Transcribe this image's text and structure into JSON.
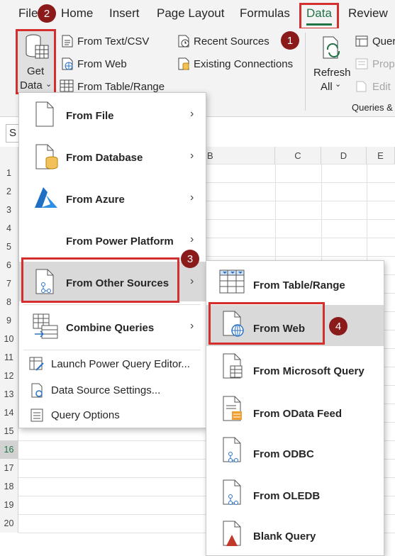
{
  "tabs": {
    "file": "File",
    "home": "Home",
    "insert": "Insert",
    "page_layout": "Page Layout",
    "formulas": "Formulas",
    "data": "Data",
    "review": "Review"
  },
  "ribbon": {
    "get_data": "Get",
    "get_data2": "Data",
    "from_text_csv": "From Text/CSV",
    "from_web": "From Web",
    "from_table_range": "From Table/Range",
    "recent_sources": "Recent Sources",
    "existing_connections": "Existing Connections",
    "refresh": "Refresh",
    "refresh_all": "All",
    "queries": "Quer",
    "properties": "Prop",
    "edit_links": "Edit",
    "group_queries": "Queries &"
  },
  "name_box": "S",
  "columns": [
    "B",
    "C",
    "D",
    "E"
  ],
  "rows": [
    "1",
    "2",
    "3",
    "4",
    "5",
    "6",
    "7",
    "8",
    "9",
    "10",
    "11",
    "12",
    "13",
    "14",
    "15",
    "16",
    "17",
    "18",
    "19",
    "20"
  ],
  "badges": {
    "b1": "1",
    "b2": "2",
    "b3": "3",
    "b4": "4"
  },
  "menu": {
    "from_file": "From File",
    "from_database": "From Database",
    "from_azure": "From Azure",
    "from_power_platform": "From Power Platform",
    "from_other_sources": "From Other Sources",
    "combine_queries": "Combine Queries",
    "launch_pq": "Launch Power Query Editor...",
    "data_source_settings": "Data Source Settings...",
    "query_options": "Query Options"
  },
  "submenu": {
    "from_table_range": "From Table/Range",
    "from_web": "From Web",
    "from_ms_query": "From Microsoft Query",
    "from_odata": "From OData Feed",
    "from_odbc": "From ODBC",
    "from_oledb": "From OLEDB",
    "blank_query": "Blank Query"
  },
  "colors": {
    "accent": "#217346",
    "annotation_red": "#d32f2f",
    "badge": "#8b1a1a",
    "highlight": "#d9d9d9"
  }
}
